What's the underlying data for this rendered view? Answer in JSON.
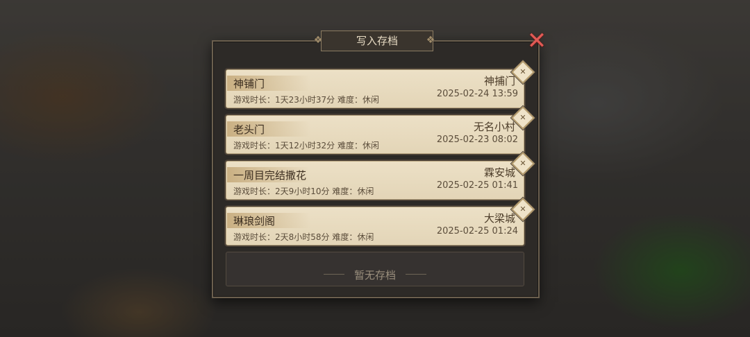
{
  "dialog": {
    "title": "写入存档",
    "close_icon": "close-x-icon",
    "colors": {
      "panel": "#2d2a27",
      "slot": "#ece0c6",
      "close": "#e05a55"
    }
  },
  "slots": [
    {
      "name": "神铺门",
      "meta": "游戏时长：1天23小时37分   难度：休闲",
      "location": "神捕门",
      "date": "2025-02-24 13:59",
      "delete_icon": "delete-diamond-icon"
    },
    {
      "name": "老头门",
      "meta": "游戏时长：1天12小时32分   难度：休闲",
      "location": "无名小村",
      "date": "2025-02-23 08:02",
      "delete_icon": "delete-diamond-icon"
    },
    {
      "name": "一周目完结撒花",
      "meta": "游戏时长：2天9小时10分    难度：休闲",
      "location": "霖安城",
      "date": "2025-02-25 01:41",
      "delete_icon": "delete-diamond-icon"
    },
    {
      "name": "琳琅剑阁",
      "meta": "游戏时长：2天8小时58分   难度：休闲",
      "location": "大梁城",
      "date": "2025-02-25 01:24",
      "delete_icon": "delete-diamond-icon"
    }
  ],
  "empty_slot": {
    "label": "暂无存档"
  }
}
